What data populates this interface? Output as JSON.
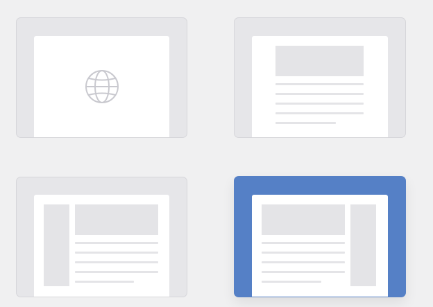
{
  "layout_picker": {
    "options": [
      {
        "id": "blank",
        "icon": "globe-icon",
        "selected": false
      },
      {
        "id": "article",
        "icon": "header-content-layout-icon",
        "selected": false
      },
      {
        "id": "left-sidebar",
        "icon": "left-sidebar-layout-icon",
        "selected": false
      },
      {
        "id": "right-sidebar",
        "icon": "right-sidebar-layout-icon",
        "selected": true
      }
    ]
  },
  "colors": {
    "background": "#f0f0f1",
    "card": "#e6e6e9",
    "card_border": "#d6d6da",
    "selected": "#5580c6",
    "paper": "#ffffff",
    "placeholder": "#e4e4e7",
    "icon_stroke": "#c9c9cf"
  }
}
